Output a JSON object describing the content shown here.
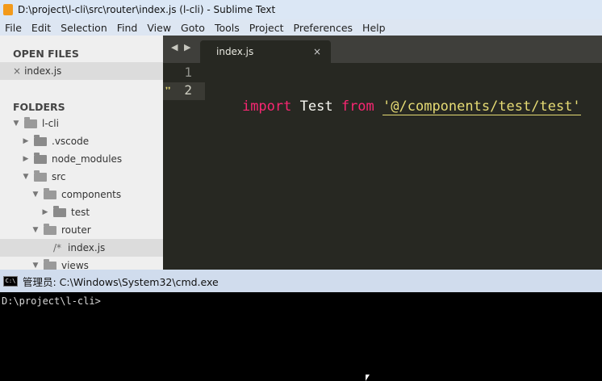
{
  "window": {
    "title": "D:\\project\\l-cli\\src\\router\\index.js (l-cli) - Sublime Text"
  },
  "menu": [
    "File",
    "Edit",
    "Selection",
    "Find",
    "View",
    "Goto",
    "Tools",
    "Project",
    "Preferences",
    "Help"
  ],
  "sidebar": {
    "open_files_heading": "OPEN FILES",
    "open_file": "index.js",
    "open_file_close": "×",
    "folders_heading": "FOLDERS",
    "tree": [
      {
        "label": "l-cli",
        "type": "folder",
        "expanded": true
      },
      {
        "label": ".vscode",
        "type": "folder",
        "expanded": false
      },
      {
        "label": "node_modules",
        "type": "folder",
        "expanded": false
      },
      {
        "label": "src",
        "type": "folder",
        "expanded": true
      },
      {
        "label": "components",
        "type": "folder",
        "expanded": true
      },
      {
        "label": "test",
        "type": "folder",
        "expanded": false
      },
      {
        "label": "router",
        "type": "folder",
        "expanded": true
      },
      {
        "label": "index.js",
        "type": "file",
        "prefix": "/*"
      },
      {
        "label": "views",
        "type": "folder",
        "expanded": true
      }
    ]
  },
  "editor": {
    "tab_nav": "◀ ▶",
    "tab": {
      "label": "index.js",
      "close": "×"
    },
    "line_numbers": [
      "1",
      "2"
    ],
    "line2": {
      "kw1": "import",
      "id": "Test",
      "kw2": "from",
      "str": "'@/components/test/test'"
    }
  },
  "cmd": {
    "title": "管理员: C:\\Windows\\System32\\cmd.exe",
    "icon_text": "C:\\",
    "prompt": "D:\\project\\l-cli>"
  },
  "colors": {
    "keyword": "#f92672",
    "string": "#e6db74",
    "editor_bg": "#272822"
  }
}
